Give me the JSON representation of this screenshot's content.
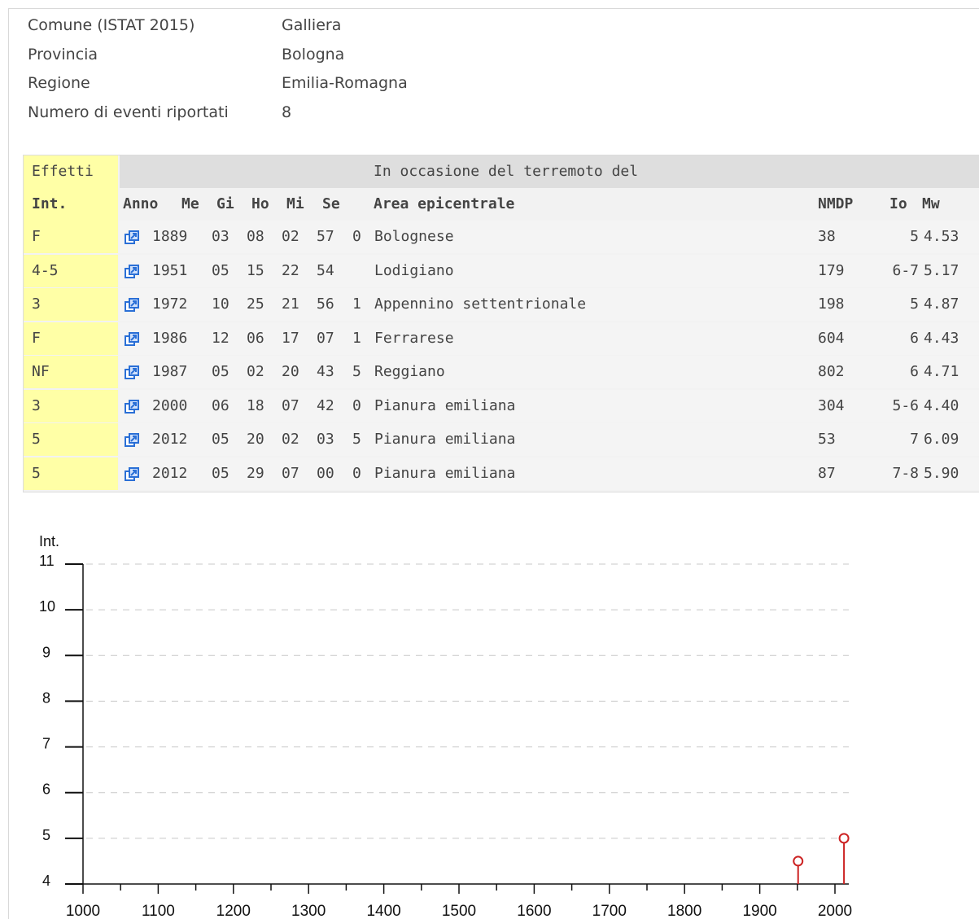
{
  "info": [
    {
      "label": "Comune (ISTAT 2015)",
      "value": "Galliera"
    },
    {
      "label": "Provincia",
      "value": "Bologna"
    },
    {
      "label": "Regione",
      "value": "Emilia-Romagna"
    },
    {
      "label": "Numero di eventi riportati",
      "value": "8"
    }
  ],
  "table": {
    "group_left": "Effetti",
    "group_right": "In occasione del terremoto del",
    "headers": {
      "int": "Int.",
      "anno": "Anno",
      "me": "Me",
      "gi": "Gi",
      "ho": "Ho",
      "mi": "Mi",
      "se": "Se",
      "area": "Area epicentrale",
      "nmdp": "NMDP",
      "io": "Io",
      "mw": "Mw"
    },
    "rows": [
      {
        "int": "F",
        "anno": "1889",
        "me": "03",
        "gi": "08",
        "ho": "02",
        "mi": "57",
        "se": "0",
        "area": "Bolognese",
        "nmdp": "38",
        "io": "5",
        "mw": "4.53"
      },
      {
        "int": "4-5",
        "anno": "1951",
        "me": "05",
        "gi": "15",
        "ho": "22",
        "mi": "54",
        "se": "",
        "area": "Lodigiano",
        "nmdp": "179",
        "io": "6-7",
        "mw": "5.17"
      },
      {
        "int": "3",
        "anno": "1972",
        "me": "10",
        "gi": "25",
        "ho": "21",
        "mi": "56",
        "se": "1",
        "area": "Appennino settentrionale",
        "nmdp": "198",
        "io": "5",
        "mw": "4.87"
      },
      {
        "int": "F",
        "anno": "1986",
        "me": "12",
        "gi": "06",
        "ho": "17",
        "mi": "07",
        "se": "1",
        "area": "Ferrarese",
        "nmdp": "604",
        "io": "6",
        "mw": "4.43"
      },
      {
        "int": "NF",
        "anno": "1987",
        "me": "05",
        "gi": "02",
        "ho": "20",
        "mi": "43",
        "se": "5",
        "area": "Reggiano",
        "nmdp": "802",
        "io": "6",
        "mw": "4.71"
      },
      {
        "int": "3",
        "anno": "2000",
        "me": "06",
        "gi": "18",
        "ho": "07",
        "mi": "42",
        "se": "0",
        "area": "Pianura emiliana",
        "nmdp": "304",
        "io": "5-6",
        "mw": "4.40"
      },
      {
        "int": "5",
        "anno": "2012",
        "me": "05",
        "gi": "20",
        "ho": "02",
        "mi": "03",
        "se": "5",
        "area": "Pianura emiliana",
        "nmdp": "53",
        "io": "7",
        "mw": "6.09"
      },
      {
        "int": "5",
        "anno": "2012",
        "me": "05",
        "gi": "29",
        "ho": "07",
        "mi": "00",
        "se": "0",
        "area": "Pianura emiliana",
        "nmdp": "87",
        "io": "7-8",
        "mw": "5.90"
      }
    ]
  },
  "chart_data": {
    "type": "scatter",
    "title": "",
    "xlabel": "",
    "ylabel": "Int.",
    "x_ticks": [
      1000,
      1100,
      1200,
      1300,
      1400,
      1500,
      1600,
      1700,
      1800,
      1900,
      2000
    ],
    "y_ticks": [
      4,
      5,
      6,
      7,
      8,
      9,
      10,
      11
    ],
    "xlim": [
      1000,
      2020
    ],
    "ylim": [
      4,
      11
    ],
    "grid": true,
    "points": [
      {
        "x": 1951,
        "y": 4.5
      },
      {
        "x": 2012,
        "y": 5
      }
    ],
    "marker_color": "#cc2222"
  },
  "colors": {
    "effetti_bg": "#ffffa6",
    "header_bg": "#dedede",
    "table_bg": "#f2f2f2",
    "link_icon": "#2a6fd6",
    "marker": "#cc2222"
  }
}
